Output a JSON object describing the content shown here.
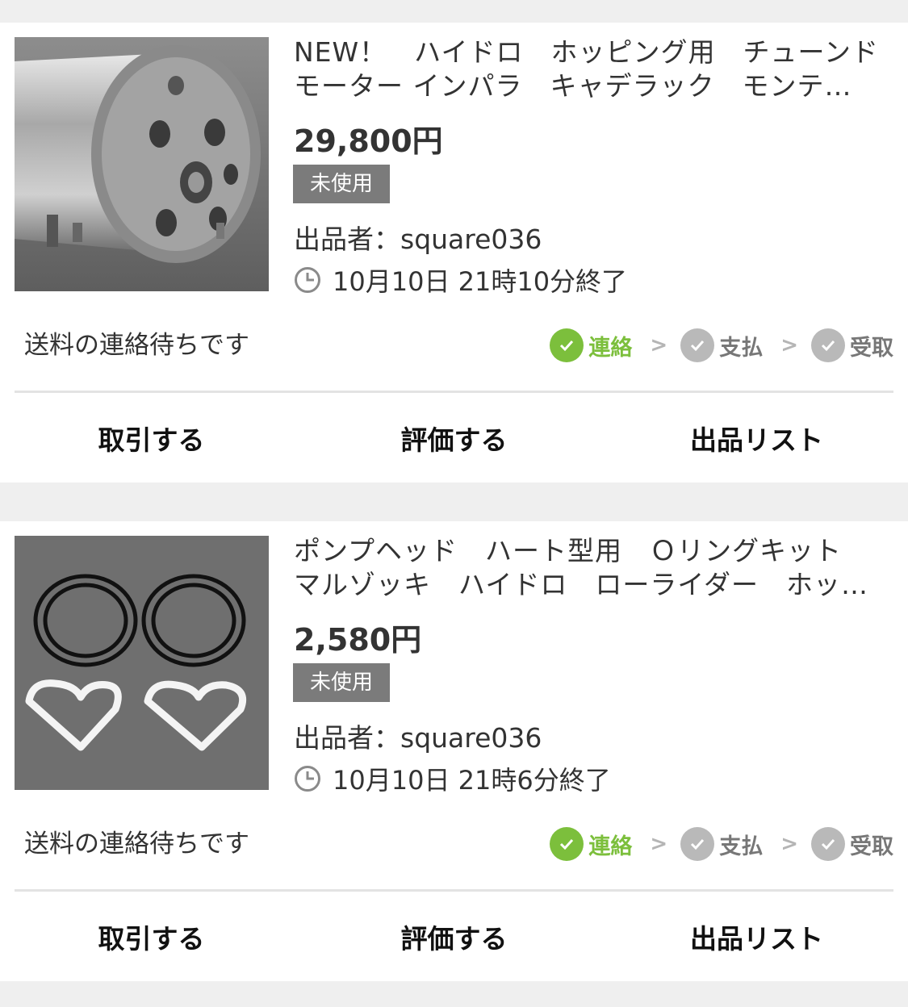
{
  "listings": [
    {
      "title_line1": "NEW！　ハイドロ　ホッピング用　チューンド",
      "title_line2": "モーター インパラ　キャデラック　モンテ…",
      "price": "29,800円",
      "condition": "未使用",
      "seller": "出品者：square036",
      "end_time": "10月10日 21時10分終了",
      "status_message": "送料の連絡待ちです",
      "steps": [
        {
          "label": "連絡",
          "state": "done"
        },
        {
          "label": "支払",
          "state": "todo"
        },
        {
          "label": "受取",
          "state": "todo"
        }
      ],
      "actions": {
        "trade": "取引する",
        "rate": "評価する",
        "list": "出品リスト"
      }
    },
    {
      "title_line1": "ポンプヘッド　ハート型用　Ｏリングキット",
      "title_line2": "マルゾッキ　ハイドロ　ローライダー　ホッ…",
      "price": "2,580円",
      "condition": "未使用",
      "seller": "出品者：square036",
      "end_time": "10月10日 21時6分終了",
      "status_message": "送料の連絡待ちです",
      "steps": [
        {
          "label": "連絡",
          "state": "done"
        },
        {
          "label": "支払",
          "state": "todo"
        },
        {
          "label": "受取",
          "state": "todo"
        }
      ],
      "actions": {
        "trade": "取引する",
        "rate": "評価する",
        "list": "出品リスト"
      }
    }
  ],
  "colors": {
    "accent_green": "#7cbf3c",
    "badge_gray": "#7b7b7b",
    "inactive_gray": "#b9b9b9"
  }
}
